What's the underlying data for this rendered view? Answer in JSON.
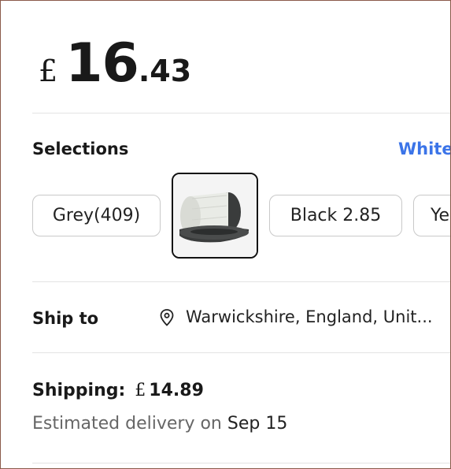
{
  "price": {
    "currency": "£",
    "integer": "16",
    "decimal": ".43"
  },
  "selections": {
    "label": "Selections",
    "selected_value": "White",
    "options": [
      {
        "label": "Grey(409)"
      },
      {
        "image": "white-filament-spool"
      },
      {
        "label": "Black 2.85"
      },
      {
        "label": "Ye"
      }
    ]
  },
  "ship_to": {
    "label": "Ship to",
    "location": "Warwickshire, England, Unit..."
  },
  "shipping": {
    "label": "Shipping:",
    "currency": "£",
    "amount": "14.89",
    "delivery_prefix": "Estimated delivery on",
    "delivery_date": "Sep 15"
  },
  "colors": {
    "accent": "#3b74e8",
    "text": "#191919",
    "muted": "#666666",
    "border": "#c9c9c9"
  },
  "icons": {
    "location": "map-pin-icon"
  }
}
